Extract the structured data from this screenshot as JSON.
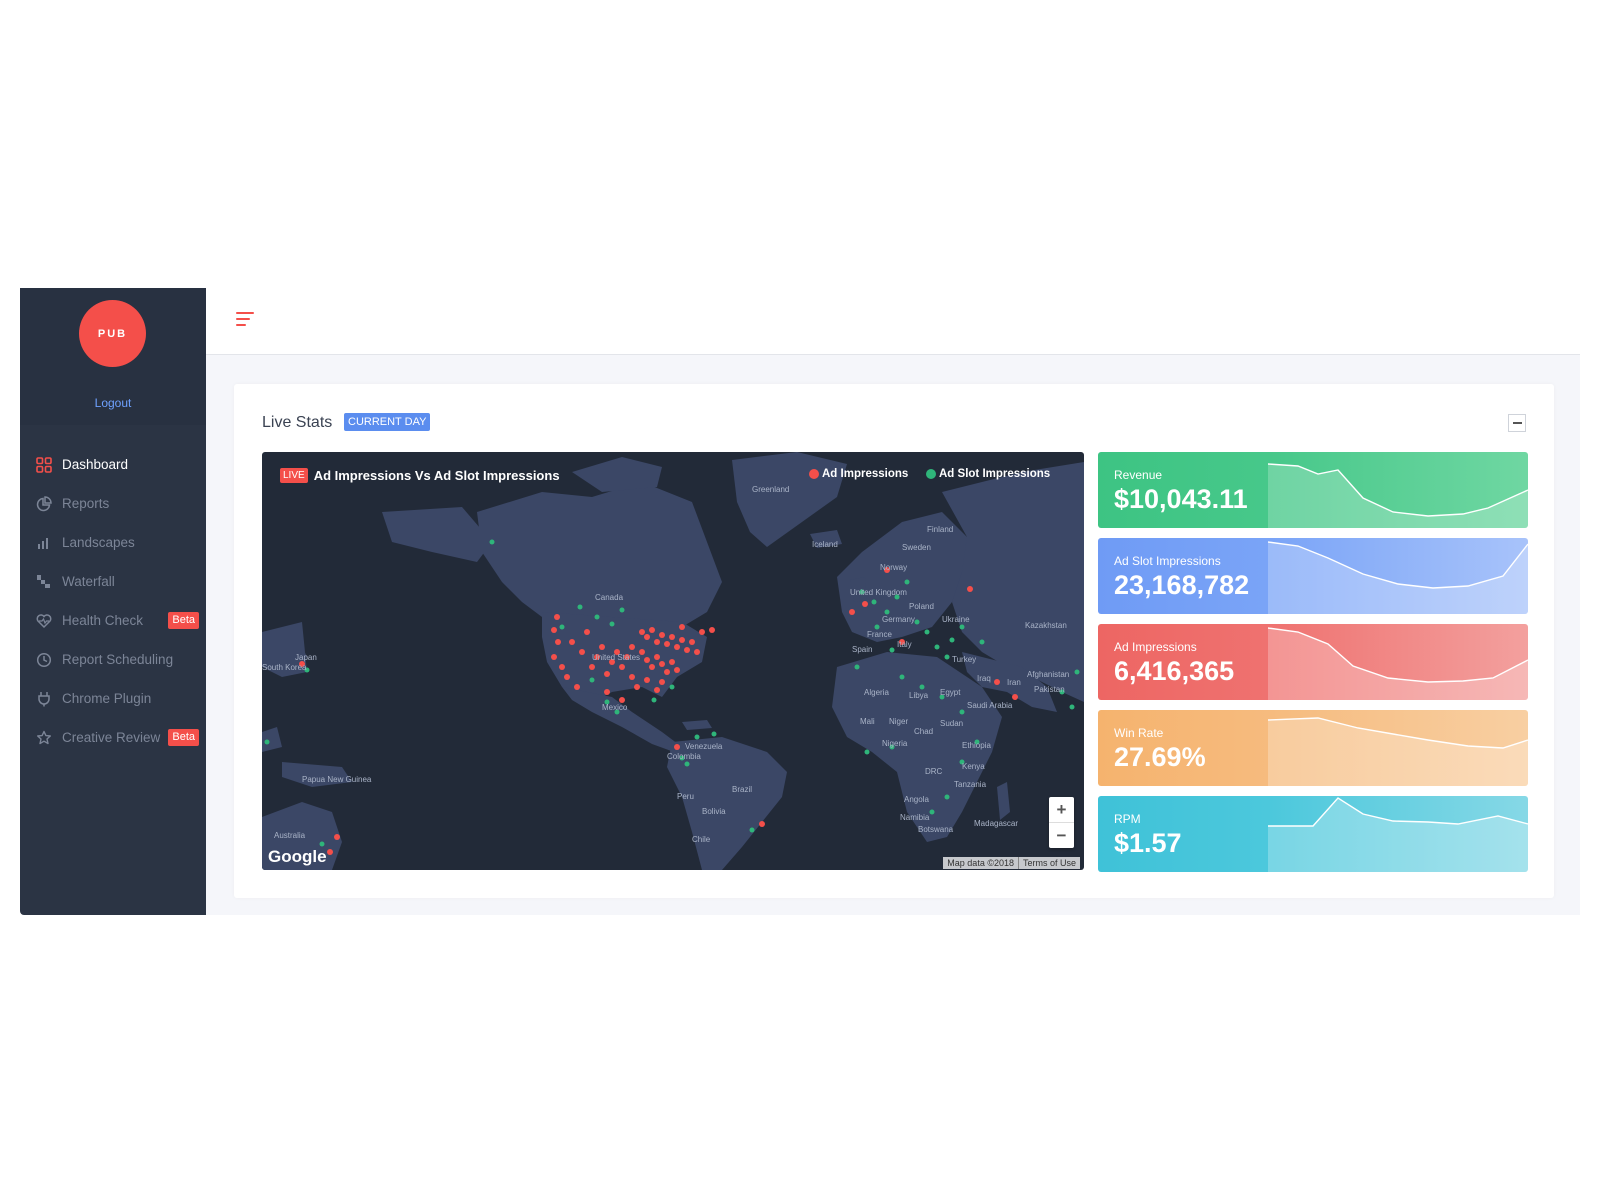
{
  "sidebar": {
    "logo_text": "PUB",
    "logout_label": "Logout",
    "items": [
      {
        "label": "Dashboard",
        "icon": "grid-icon",
        "active": true
      },
      {
        "label": "Reports",
        "icon": "pie-chart-icon"
      },
      {
        "label": "Landscapes",
        "icon": "bar-chart-icon"
      },
      {
        "label": "Waterfall",
        "icon": "waterfall-icon"
      },
      {
        "label": "Health Check",
        "icon": "heart-pulse-icon",
        "badge": "Beta"
      },
      {
        "label": "Report Scheduling",
        "icon": "clock-icon"
      },
      {
        "label": "Chrome Plugin",
        "icon": "plug-icon"
      },
      {
        "label": "Creative Review",
        "icon": "star-icon",
        "badge": "Beta"
      }
    ]
  },
  "card": {
    "title": "Live Stats",
    "badge": "CURRENT DAY"
  },
  "map": {
    "live_badge": "LIVE",
    "title": "Ad Impressions Vs Ad Slot Impressions",
    "legend": [
      {
        "label": "Ad Impressions",
        "color": "#f44f4a"
      },
      {
        "label": "Ad Slot Impressions",
        "color": "#2fb57a"
      }
    ],
    "zoom_in": "+",
    "zoom_out": "−",
    "provider": "Google",
    "map_data": "Map data ©2018",
    "terms": "Terms of Use",
    "labels": [
      "Greenland",
      "Iceland",
      "Finland",
      "Sweden",
      "Norway",
      "United Kingdom",
      "Poland",
      "Germany",
      "Ukraine",
      "Kazakhstan",
      "France",
      "Spain",
      "Italy",
      "Turkey",
      "Afghanistan",
      "Iraq",
      "Iran",
      "Pakistan",
      "Algeria",
      "Libya",
      "Egypt",
      "Saudi Arabia",
      "Mali",
      "Niger",
      "Chad",
      "Sudan",
      "Nigeria",
      "Ethiopia",
      "DRC",
      "Kenya",
      "Tanzania",
      "Angola",
      "Namibia",
      "Botswana",
      "Madagascar",
      "Canada",
      "United States",
      "Mexico",
      "Venezuela",
      "Colombia",
      "Brazil",
      "Peru",
      "Bolivia",
      "Chile",
      "Japan",
      "South Korea",
      "Papua New Guinea",
      "Australia"
    ]
  },
  "stats": [
    {
      "label": "Revenue",
      "value": "$10,043.11",
      "color": "#3dc483"
    },
    {
      "label": "Ad Slot Impressions",
      "value": "23,168,782",
      "color": "#6f9bf5"
    },
    {
      "label": "Ad Impressions",
      "value": "6,416,365",
      "color": "#ed6663"
    },
    {
      "label": "Win Rate",
      "value": "27.69%",
      "color": "#f5b36e"
    },
    {
      "label": "RPM",
      "value": "$1.57",
      "color": "#3fc2d8"
    }
  ]
}
